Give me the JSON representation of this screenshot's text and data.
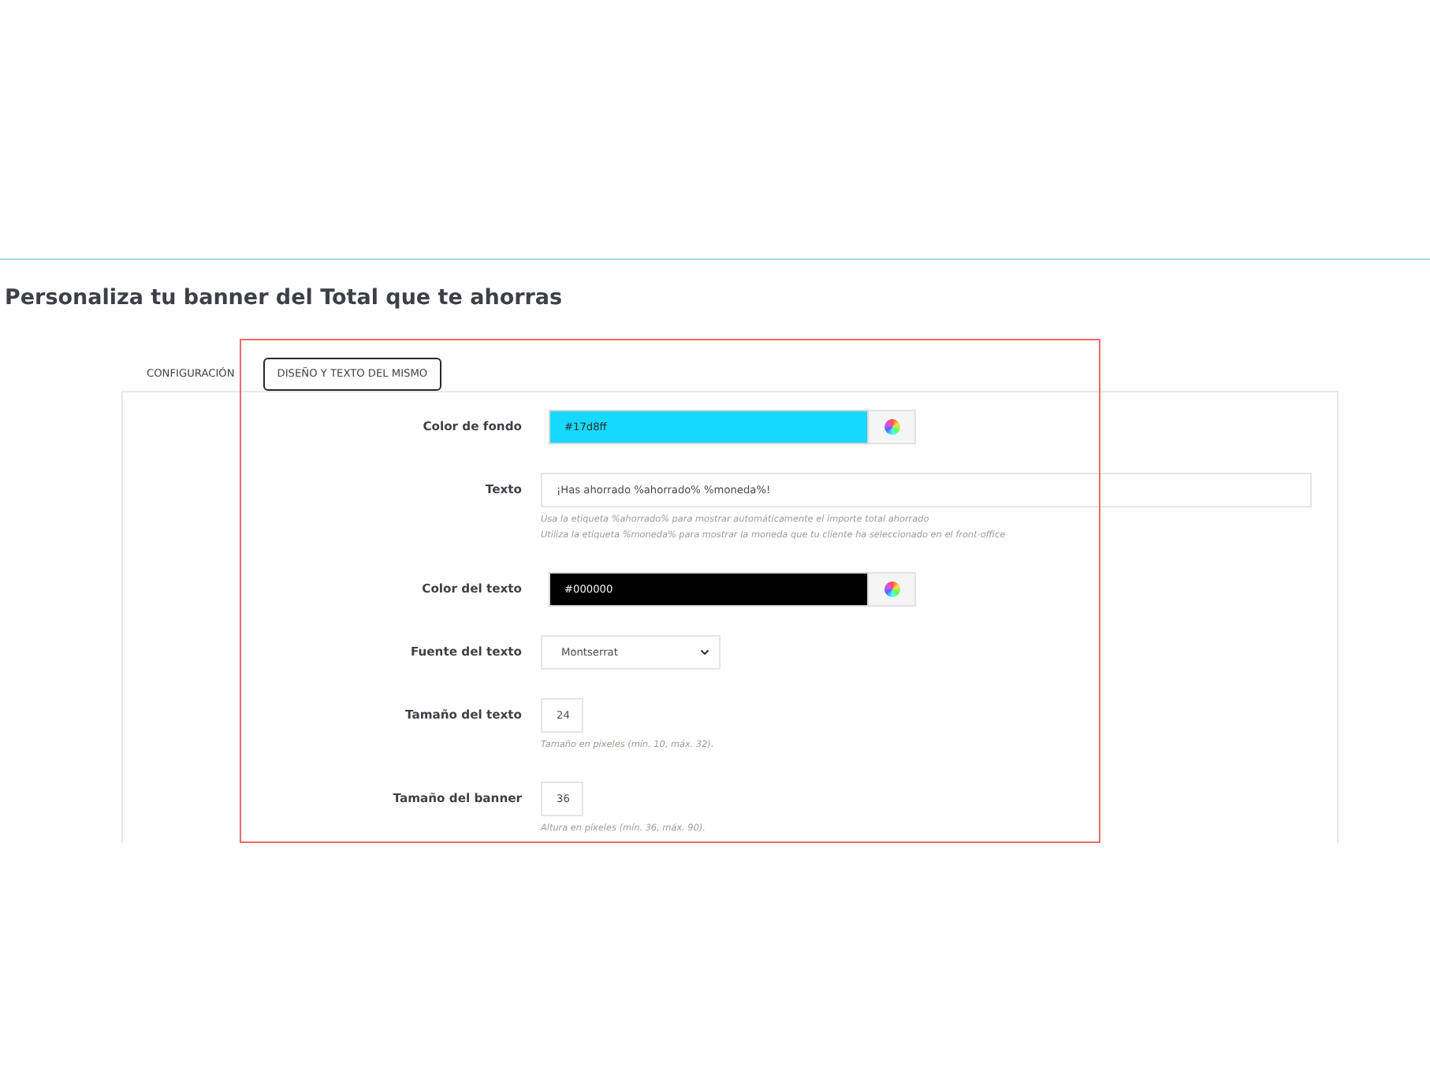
{
  "title": "Personaliza tu banner del Total que te ahorras",
  "tabs": [
    {
      "label": "CONFIGURACIÓN",
      "selected": false
    },
    {
      "label": "DISEÑO Y TEXTO DEL MISMO",
      "selected": true
    }
  ],
  "fields": [
    {
      "kind": "color",
      "label": "Color de fondo",
      "value": "#17d8ff",
      "color": "#17d8ff"
    },
    {
      "kind": "text",
      "label": "Texto",
      "value": "¡Has ahorrado %ahorrado% %moneda%!",
      "help": [
        "Usa la etiqueta %ahorrado% para mostrar automáticamente el importe total ahorrado",
        "Utiliza la etiqueta %moneda% para mostrar la moneda que tu cliente ha seleccionado en el front-office"
      ]
    },
    {
      "kind": "color",
      "label": "Color del texto",
      "value": "#000000",
      "color": "#000000"
    },
    {
      "kind": "select",
      "label": "Fuente del texto",
      "value": "Montserrat"
    },
    {
      "kind": "number",
      "label": "Tamaño del texto",
      "value": "24",
      "help": [
        "Tamaño en píxeles (mín. 10, máx. 32)."
      ]
    },
    {
      "kind": "number",
      "label": "Tamaño del banner",
      "value": "36",
      "help": [
        "Altura en píxeles (mín. 36, máx. 90)."
      ]
    }
  ]
}
